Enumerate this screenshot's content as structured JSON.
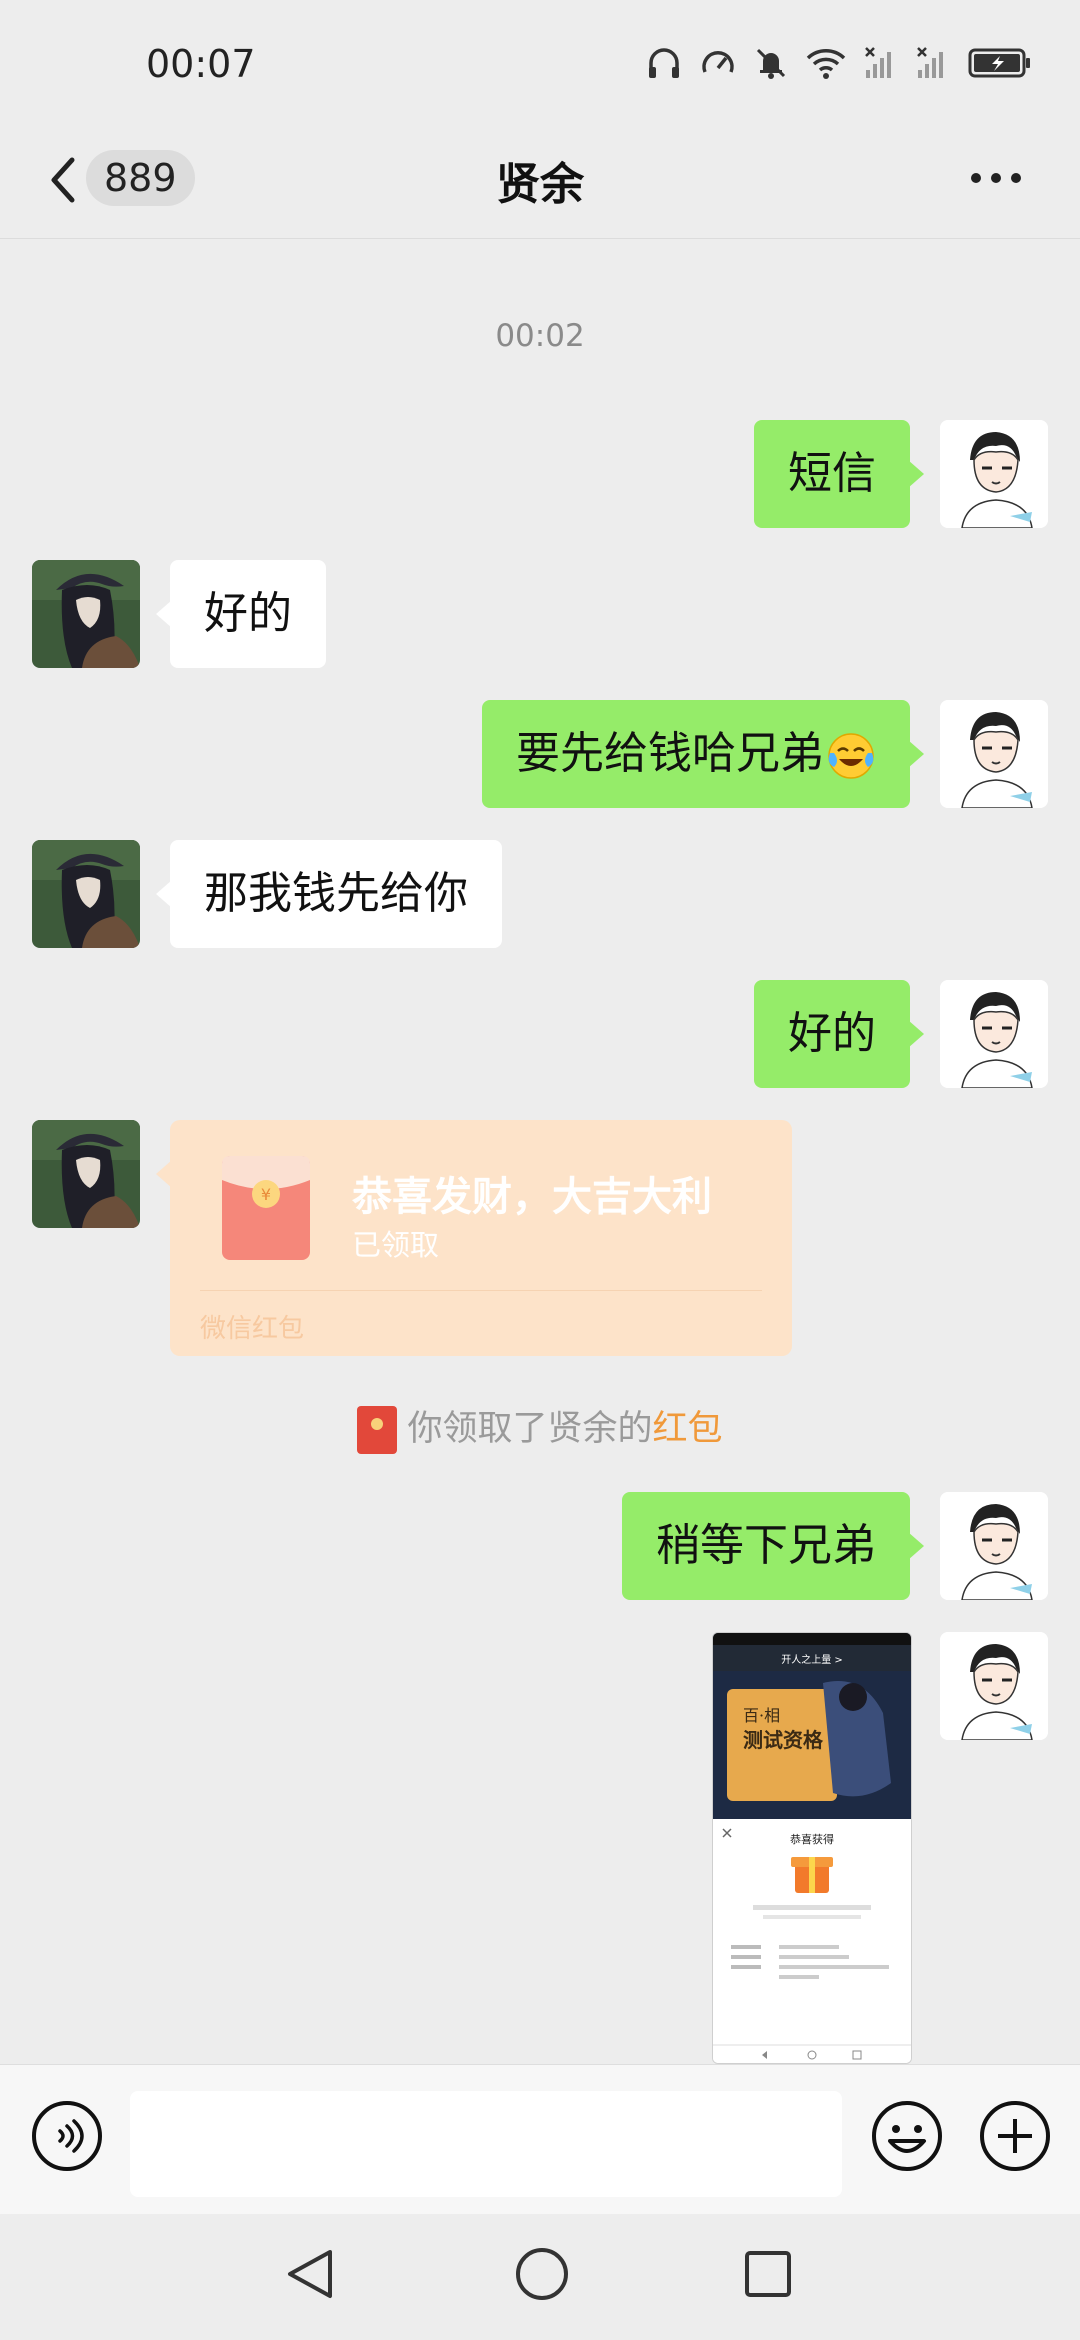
{
  "status_bar": {
    "time": "00:07"
  },
  "header": {
    "unread_count": "889",
    "title": "贤余"
  },
  "chat": {
    "timestamp": "00:02",
    "messages": [
      {
        "side": "out",
        "text": "短信"
      },
      {
        "side": "in",
        "text": "好的"
      },
      {
        "side": "out",
        "text": "要先给钱哈兄弟"
      },
      {
        "side": "in",
        "text": "那我钱先给你"
      },
      {
        "side": "out",
        "text": "好的"
      },
      {
        "side": "out",
        "text": "稍等下兄弟"
      }
    ],
    "red_packet": {
      "title": "恭喜发财，大吉大利",
      "status": "已领取",
      "label": "微信红包"
    },
    "notice": {
      "text": "你领取了贤余的",
      "highlight": "红包"
    }
  },
  "screenshot_thumb": {
    "nav_title": "开人之上量 >",
    "banner_title": "百·相",
    "banner_sub": "测试资格",
    "popup_title": "恭喜获得"
  },
  "colors": {
    "out_bubble": "#95ec69",
    "in_bubble": "#ffffff",
    "background": "#ededed",
    "red_packet": "#fde3c9",
    "notice_highlight": "#f0993a"
  }
}
